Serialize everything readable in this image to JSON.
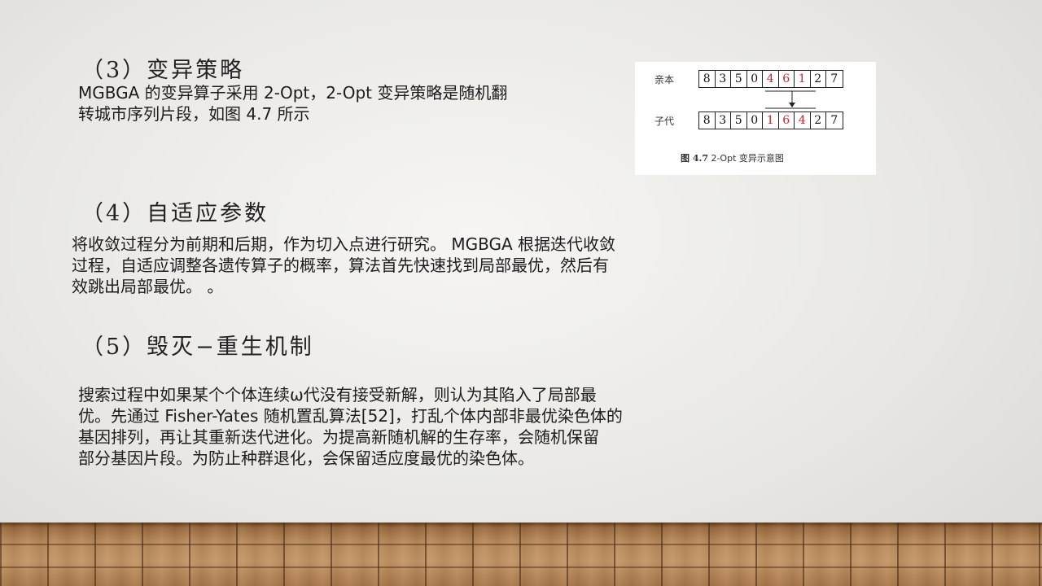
{
  "section3": {
    "heading": "（3）变异策略",
    "lines": [
      "MGBGA 的变异算子采用 2-Opt，2-Opt 变异策略是随机翻",
      "转城市序列片段，如图 4.7 所示"
    ]
  },
  "figure": {
    "parent_label": "亲本",
    "child_label": "子代",
    "parent_cells": [
      "8",
      "3",
      "5",
      "0",
      "4",
      "6",
      "1",
      "2",
      "7"
    ],
    "child_cells": [
      "8",
      "3",
      "5",
      "0",
      "1",
      "6",
      "4",
      "2",
      "7"
    ],
    "highlight_indices": [
      4,
      5,
      6
    ],
    "highlight_color": "#d0202a",
    "caption_prefix": "图 4.7",
    "caption_text": " 2-Opt 变异示意图"
  },
  "section4": {
    "heading": "（4）自适应参数",
    "lines": [
      "将收敛过程分为前期和后期，作为切入点进行研究。 MGBGA 根据迭代收敛",
      "过程，自适应调整各遗传算子的概率，算法首先快速找到局部最优，然后有",
      "效跳出局部最优。 。"
    ]
  },
  "section5": {
    "heading": "（5）毁灭−重生机制",
    "lines": [
      "搜索过程中如果某个个体连续ω代没有接受新解，则认为其陷入了局部最",
      "优。先通过 Fisher-Yates 随机置乱算法[52]，打乱个体内部非最优染色体的",
      "基因排列，再让其重新迭代进化。为提高新随机解的生存率，会随机保留",
      "部分基因片段。为防止种群退化，会保留适应度最优的染色体。"
    ]
  }
}
